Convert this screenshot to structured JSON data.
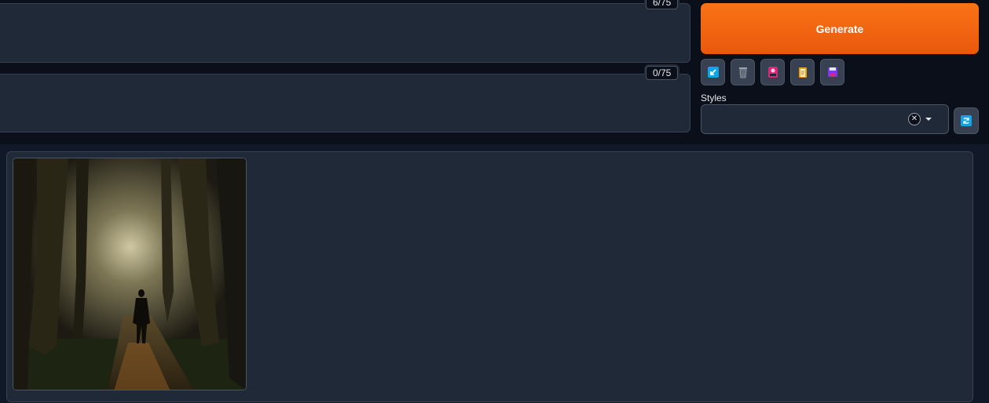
{
  "prompt": {
    "token_counter": "6/75"
  },
  "negative_prompt": {
    "token_counter": "0/75"
  },
  "actions": {
    "generate_label": "Generate"
  },
  "toolbar": {
    "buttons": [
      {
        "icon": "arrow-down-left-icon",
        "color": "#0ea5e9"
      },
      {
        "icon": "trash-icon",
        "color": "#9ca3af"
      },
      {
        "icon": "picture-card-icon",
        "color": "#db2777"
      },
      {
        "icon": "clipboard-icon",
        "color": "#f59e0b"
      },
      {
        "icon": "floppy-save-icon",
        "color": "#7c3aed"
      }
    ]
  },
  "styles": {
    "label": "Styles",
    "selected": "",
    "clear_icon": "close-icon",
    "dropdown_icon": "caret-down-icon",
    "refresh_icon": "refresh-icon"
  },
  "gallery": {
    "items": [
      {
        "image": "forest-path-man-walking"
      }
    ]
  },
  "colors": {
    "accent": "#f97316",
    "background": "#0b0f19",
    "panel": "#1f2937"
  }
}
